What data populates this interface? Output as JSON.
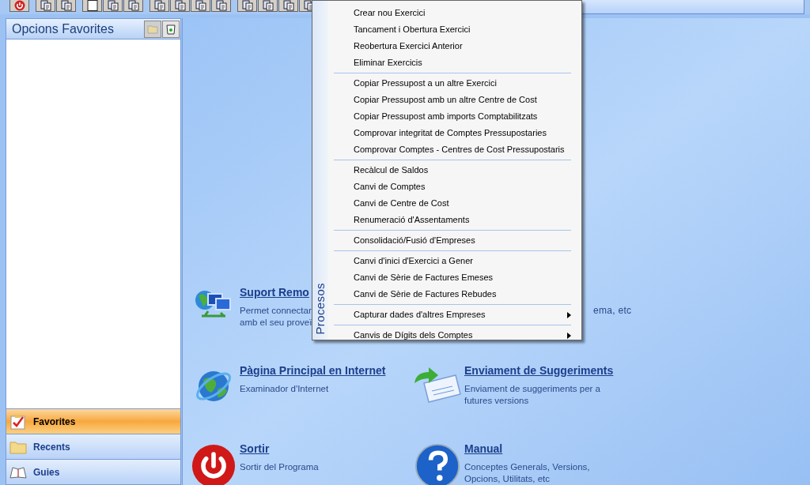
{
  "sidebar": {
    "title": "Opcions Favorites",
    "nav": [
      {
        "label": "Favorites",
        "selected": true,
        "kind": "favorites"
      },
      {
        "label": "Recents",
        "selected": false,
        "kind": "folder"
      },
      {
        "label": "Guies",
        "selected": false,
        "kind": "book"
      }
    ]
  },
  "launcher": [
    {
      "kind": "remote",
      "title": "Suport Remo",
      "lines": [
        "Permet connectar",
        "amb el seu proveï"
      ],
      "tail": "ema, etc"
    },
    {
      "kind": "none"
    },
    {
      "kind": "globe",
      "title": "Pàgina Principal en Internet",
      "lines": [
        "Examinador d'Internet"
      ]
    },
    {
      "kind": "mail",
      "title": "Enviament de Suggeriments",
      "lines": [
        "Enviament de suggeriments per a",
        "futures versions"
      ]
    },
    {
      "kind": "power",
      "title": "Sortir",
      "lines": [
        "Sortir del Programa"
      ]
    },
    {
      "kind": "help",
      "title": "Manual",
      "lines": [
        "Conceptes Generals, Versions,",
        "Opcions, Utilitats, etc"
      ]
    }
  ],
  "menu": {
    "side_label": "Procesos",
    "groups": [
      [
        "Crear nou Exercici",
        "Tancament i Obertura Exercici",
        "Reobertura Exercici Anterior",
        "Eliminar Exercicis"
      ],
      [
        "Copiar Pressupost a un altre Exercici",
        "Copiar Pressupost amb un altre Centre de Cost",
        "Copiar Pressupost amb imports Comptabilitzats",
        "Comprovar integritat de Comptes Pressupostaries",
        "Comprovar Comptes - Centres de Cost Pressupostaris"
      ],
      [
        "Recàlcul de Saldos",
        "Canvi de Comptes",
        "Canvi de Centre de Cost",
        "Renumeració d'Assentaments"
      ],
      [
        "Consolidació/Fusió d'Empreses"
      ],
      [
        "Canvi d'inici d'Exercici a Gener",
        "Canvi de Sèrie de Factures Emeses",
        "Canvi de Sèrie de Factures Rebudes"
      ],
      [
        {
          "label": "Capturar dades d'altres Empreses",
          "submenu": true
        }
      ],
      [
        {
          "label": "Canvis de Dígits dels Comptes",
          "submenu": true
        }
      ]
    ]
  }
}
